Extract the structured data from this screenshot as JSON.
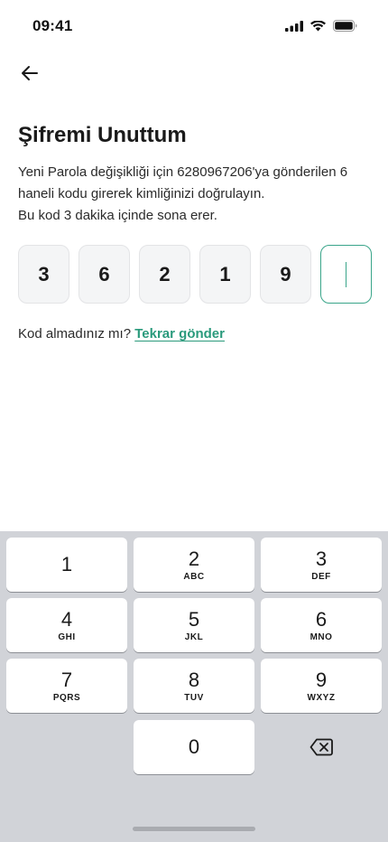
{
  "status_bar": {
    "time": "09:41",
    "icons": [
      "signal-icon",
      "wifi-icon",
      "battery-icon"
    ]
  },
  "header": {
    "back_icon": "arrow-left-icon"
  },
  "title": "Şifremi Unuttum",
  "description": {
    "line1": "Yeni Parola değişikliği için 6280967206'ya gönderilen 6",
    "line2": "haneli kodu girerek kimliğinizi doğrulayın.",
    "line3": "Bu kod 3 dakika içinde sona erer."
  },
  "otp": {
    "digits": [
      "3",
      "6",
      "2",
      "1",
      "9",
      ""
    ],
    "active_index": 5
  },
  "resend": {
    "prompt": "Kod almadınız mı?",
    "link": "Tekrar gönder"
  },
  "keyboard": {
    "keys": [
      {
        "digit": "1",
        "letters": ""
      },
      {
        "digit": "2",
        "letters": "ABC"
      },
      {
        "digit": "3",
        "letters": "DEF"
      },
      {
        "digit": "4",
        "letters": "GHI"
      },
      {
        "digit": "5",
        "letters": "JKL"
      },
      {
        "digit": "6",
        "letters": "MNO"
      },
      {
        "digit": "7",
        "letters": "PQRS"
      },
      {
        "digit": "8",
        "letters": "TUV"
      },
      {
        "digit": "9",
        "letters": "WXYZ"
      },
      {
        "digit": "0",
        "letters": ""
      }
    ],
    "delete_icon": "backspace-icon"
  },
  "colors": {
    "accent": "#2a9a7c",
    "keyboard_bg": "#d1d3d8",
    "otp_bg": "#f4f5f6"
  }
}
